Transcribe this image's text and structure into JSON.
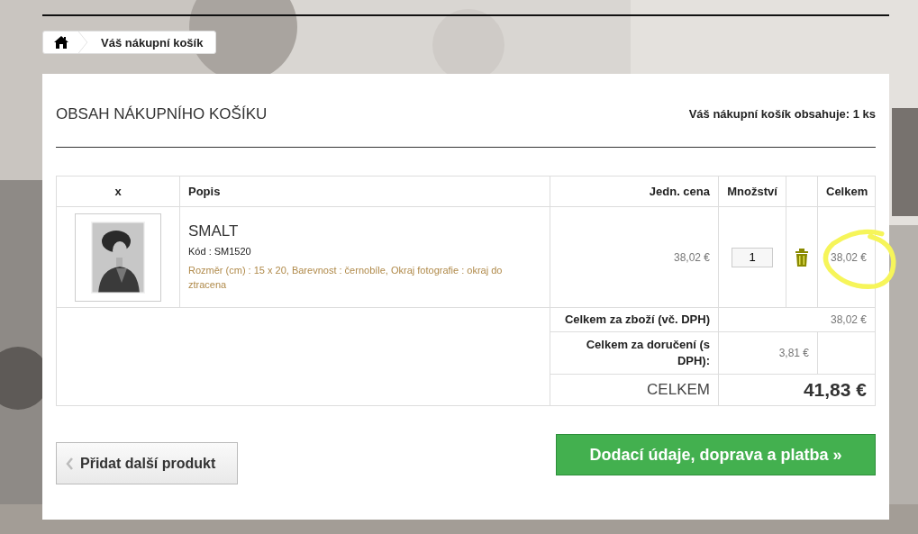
{
  "breadcrumb": {
    "current": "Váš nákupní košík"
  },
  "cart": {
    "title": "OBSAH NÁKUPNÍHO KOŠÍKU",
    "count_text": "Váš nákupní košík obsahuje: 1 ks"
  },
  "table": {
    "columns": [
      "x",
      "Popis",
      "Jedn. cena",
      "Množství",
      "Celkem"
    ],
    "rows": [
      {
        "name": "SMALT",
        "code": "Kód : SM1520",
        "attributes": "Rozměr (cm) : 15 x 20, Barevnost : černobíle, Okraj fotografie : okraj do ztracena",
        "unit_price": "38,02 €",
        "quantity": "1",
        "total": "38,02 €",
        "highlighted": true
      }
    ],
    "totals": [
      {
        "kind": "goods",
        "label": "Celkem za zboží (vč. DPH)",
        "value": "38,02 €"
      },
      {
        "kind": "shipping",
        "label": "Celkem za doručení (s DPH):",
        "value": "3,81 €"
      },
      {
        "kind": "grand",
        "label": "CELKEM",
        "value": "41,83 €"
      }
    ]
  },
  "buttons": {
    "back": "Přidat další produkt",
    "next": "Dodací údaje, doprava a platba »"
  }
}
